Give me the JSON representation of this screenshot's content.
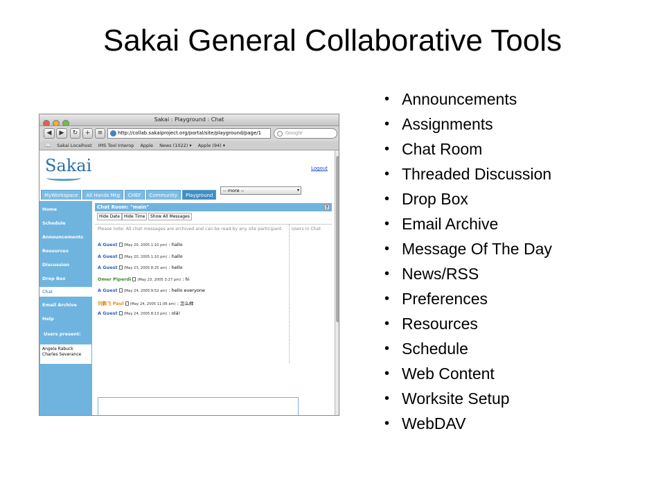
{
  "slide": {
    "title": "Sakai General Collaborative Tools",
    "bullets": [
      "Announcements",
      "Assignments",
      "Chat Room",
      "Threaded Discussion",
      "Drop Box",
      "Email Archive",
      "Message Of The Day",
      "News/RSS",
      "Preferences",
      "Resources",
      "Schedule",
      "Web Content",
      "Worksite Setup",
      "WebDAV"
    ]
  },
  "browser": {
    "window_title": "Sakai : Playground : Chat",
    "url": "http://collab.sakaiproject.org/portal/site/playground/page/1",
    "search_placeholder": "Google",
    "bookmarks": [
      "Sakai Localhost",
      "IMS Tool Interop",
      "Apple",
      "News (1022) ▾",
      "Apple (94) ▾"
    ]
  },
  "sakai": {
    "logo": "Sakai",
    "logout": "Logout",
    "tabs": [
      "MyWorkspace",
      "All Hands Mtg",
      "CHEF",
      "Community",
      "Playground"
    ],
    "active_tab": "Playground",
    "more_select": "-- more --",
    "nav": [
      "Home",
      "Schedule",
      "Announcements",
      "Resources",
      "Discussion",
      "Drop Box",
      "Chat",
      "Email Archive",
      "Help"
    ],
    "current_nav": "Chat",
    "users_present_label": "Users present:",
    "users_present": [
      "Angela Rabuck",
      "Charles Severance"
    ],
    "portlet_title": "Chat Room: \"main\"",
    "help_icon": "?",
    "filters": [
      "Hide Date",
      "Hide Time",
      "Show All Messages"
    ],
    "note": "Please note: All chat messages are archived and can be read by any site participant.",
    "users_in_chat": "Users in Chat",
    "messages": [
      {
        "author": "A Guest",
        "date": "(May 20, 2005 1:10 pm)",
        "text": ": hallo",
        "color": "#2a5fbf"
      },
      {
        "author": "A Guest",
        "date": "(May 20, 2005 1:10 pm)",
        "text": ": hallo",
        "color": "#2a5fbf"
      },
      {
        "author": "A Guest",
        "date": "(May 23, 2005 8:25 am)",
        "text": ": hello",
        "color": "#2a5fbf"
      },
      {
        "author": "Omer Piperdi",
        "date": "(May 23, 2005 3:27 pm)",
        "text": ": hi",
        "color": "#3a8a2a"
      },
      {
        "author": "A Guest",
        "date": "(May 24, 2005 9:52 am)",
        "text": ": hello everyone",
        "color": "#2a5fbf"
      },
      {
        "author": "刘鹏飞 Paul",
        "date": "(May 24, 2005 11:06 am)",
        "text": ": 怎么样",
        "color": "#e08a1a"
      },
      {
        "author": "A Guest",
        "date": "(May 24, 2005 8:13 pm)",
        "text": ": olá!",
        "color": "#2a5fbf"
      }
    ]
  }
}
